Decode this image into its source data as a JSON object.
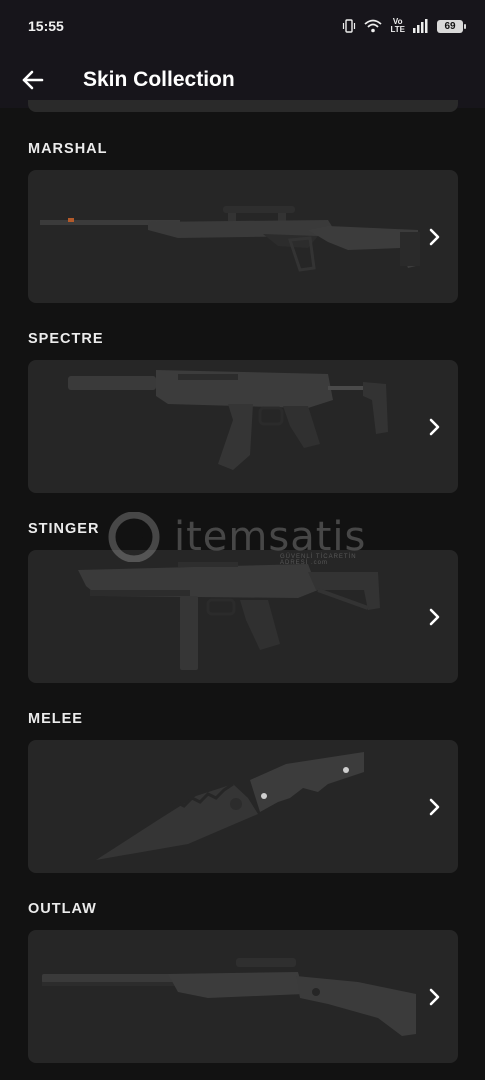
{
  "status_bar": {
    "time": "15:55",
    "network_label": "Vo\nLTE",
    "battery": "69"
  },
  "header": {
    "title": "Skin Collection",
    "back_icon": "arrow-left-icon"
  },
  "watermark": {
    "text": "itemsatis",
    "subtext": "GÜVENLİ TİCARETİN ADRESİ  .com"
  },
  "sections": [
    {
      "title": "MARSHAL",
      "weapon_icon": "marshal-rifle",
      "action_icon": "chevron-right-icon"
    },
    {
      "title": "SPECTRE",
      "weapon_icon": "spectre-smg",
      "action_icon": "chevron-right-icon"
    },
    {
      "title": "STINGER",
      "weapon_icon": "stinger-smg",
      "action_icon": "chevron-right-icon"
    },
    {
      "title": "MELEE",
      "weapon_icon": "melee-knife",
      "action_icon": "chevron-right-icon"
    },
    {
      "title": "OUTLAW",
      "weapon_icon": "outlaw-rifle",
      "action_icon": "chevron-right-icon"
    }
  ],
  "colors": {
    "background": "#121212",
    "header": "#17151b",
    "card": "#262626",
    "weapon": "#3a3a3a"
  }
}
